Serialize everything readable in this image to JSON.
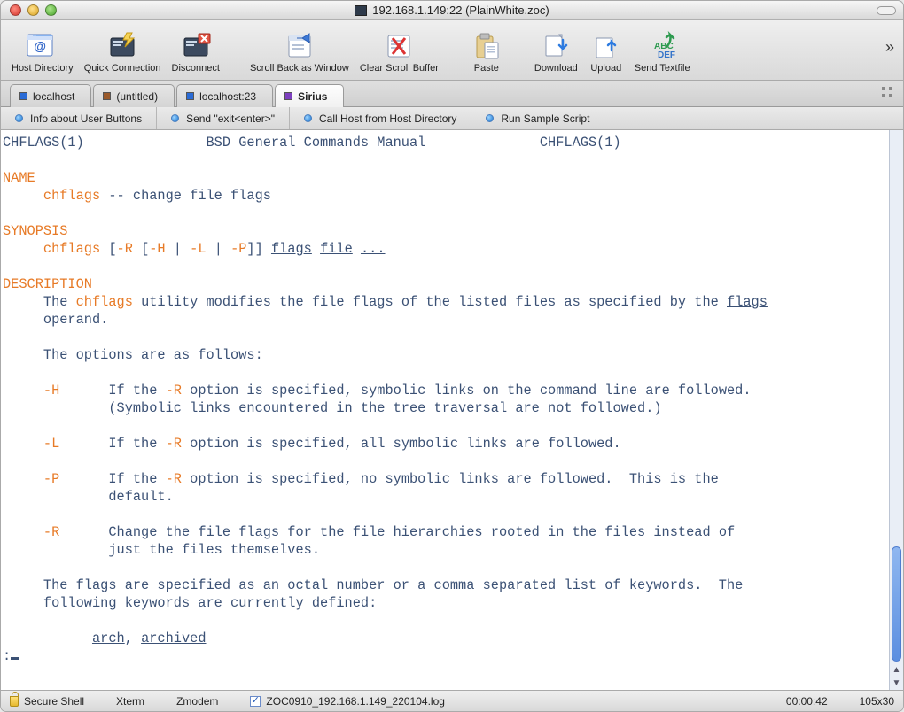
{
  "window": {
    "title": "192.168.1.149:22 (PlainWhite.zoc)"
  },
  "toolbar": [
    {
      "id": "host-directory",
      "label": "Host Directory"
    },
    {
      "id": "quick-connection",
      "label": "Quick Connection"
    },
    {
      "id": "disconnect",
      "label": "Disconnect"
    },
    {
      "id": "_gap"
    },
    {
      "id": "scroll-back",
      "label": "Scroll Back as Window"
    },
    {
      "id": "clear-buffer",
      "label": "Clear Scroll Buffer"
    },
    {
      "id": "_gap"
    },
    {
      "id": "paste",
      "label": "Paste"
    },
    {
      "id": "_gap"
    },
    {
      "id": "download",
      "label": "Download"
    },
    {
      "id": "upload",
      "label": "Upload"
    },
    {
      "id": "send-textfile",
      "label": "Send Textfile"
    }
  ],
  "tabs": [
    {
      "label": "localhost",
      "color": "blue",
      "active": false
    },
    {
      "label": "(untitled)",
      "color": "brown",
      "active": false
    },
    {
      "label": "localhost:23",
      "color": "blue",
      "active": false
    },
    {
      "label": "Sirius",
      "color": "purple",
      "active": true
    }
  ],
  "userButtons": [
    {
      "label": "Info about User Buttons"
    },
    {
      "label": "Send \"exit<enter>\""
    },
    {
      "label": "Call Host from Host Directory"
    },
    {
      "label": "Run Sample Script"
    }
  ],
  "terminal": {
    "header_left": "CHFLAGS(1)",
    "header_center": "BSD General Commands Manual",
    "header_right": "CHFLAGS(1)",
    "sec_name": "NAME",
    "name_cmd": "chflags",
    "name_text": " -- change file flags",
    "sec_syn": "SYNOPSIS",
    "syn_cmd": "chflags",
    "syn_open": " [",
    "syn_R": "-R",
    "syn_mid": " [",
    "syn_H": "-H",
    "syn_pipe1": " | ",
    "syn_L": "-L",
    "syn_pipe2": " | ",
    "syn_P": "-P",
    "syn_close": "]] ",
    "syn_flags": "flags",
    "syn_sp": " ",
    "syn_file": "file",
    "syn_dots": "...",
    "sec_desc": "DESCRIPTION",
    "d1a": "     The ",
    "d1cmd": "chflags",
    "d1b": " utility modifies the file flags of the listed files as specified by the ",
    "d1f": "flags",
    "d2": "     operand.",
    "d3": "     The options are as follows:",
    "oH": "-H",
    "oH1a": "      If the ",
    "oR": "-R",
    "oH1b": " option is specified, symbolic links on the command line are followed.",
    "oH2": "             (Symbolic links encountered in the tree traversal are not followed.)",
    "oL": "-L",
    "oL1a": "      If the ",
    "oL1b": " option is specified, all symbolic links are followed.",
    "oP": "-P",
    "oP1a": "      If the ",
    "oP1b": " option is specified, no symbolic links are followed.  This is the",
    "oP2": "             default.",
    "oRr": "-R",
    "oR1": "      Change the file flags for the file hierarchies rooted in the files instead of",
    "oR2": "             just the files themselves.",
    "f1": "     The flags are specified as an octal number or a comma separated list of keywords.  The",
    "f2": "     following keywords are currently defined:",
    "kw_indent": "           ",
    "kw_arch": "arch",
    "kw_sep": ", ",
    "kw_archived": "archived",
    "prompt": ":"
  },
  "status": {
    "protocol": "Secure Shell",
    "term": "Xterm",
    "transfer": "Zmodem",
    "logfile": "ZOC0910_192.168.1.149_220104.log",
    "elapsed": "00:00:42",
    "size": "105x30"
  }
}
